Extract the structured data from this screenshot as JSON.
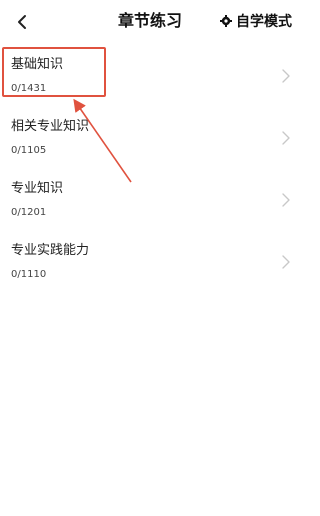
{
  "header": {
    "title": "章节练习",
    "mode_label": "自学模式"
  },
  "chapters": [
    {
      "name": "基础知识",
      "progress": "0/1431"
    },
    {
      "name": "相关专业知识",
      "progress": "0/1105"
    },
    {
      "name": "专业知识",
      "progress": "0/1201"
    },
    {
      "name": "专业实践能力",
      "progress": "0/1110"
    }
  ],
  "colors": {
    "annotation": "#e0523f",
    "chevron": "#c8c8c8"
  },
  "icons": {
    "back": "chevron-left-icon",
    "mode": "gear-icon",
    "item_arrow": "chevron-right-icon"
  }
}
